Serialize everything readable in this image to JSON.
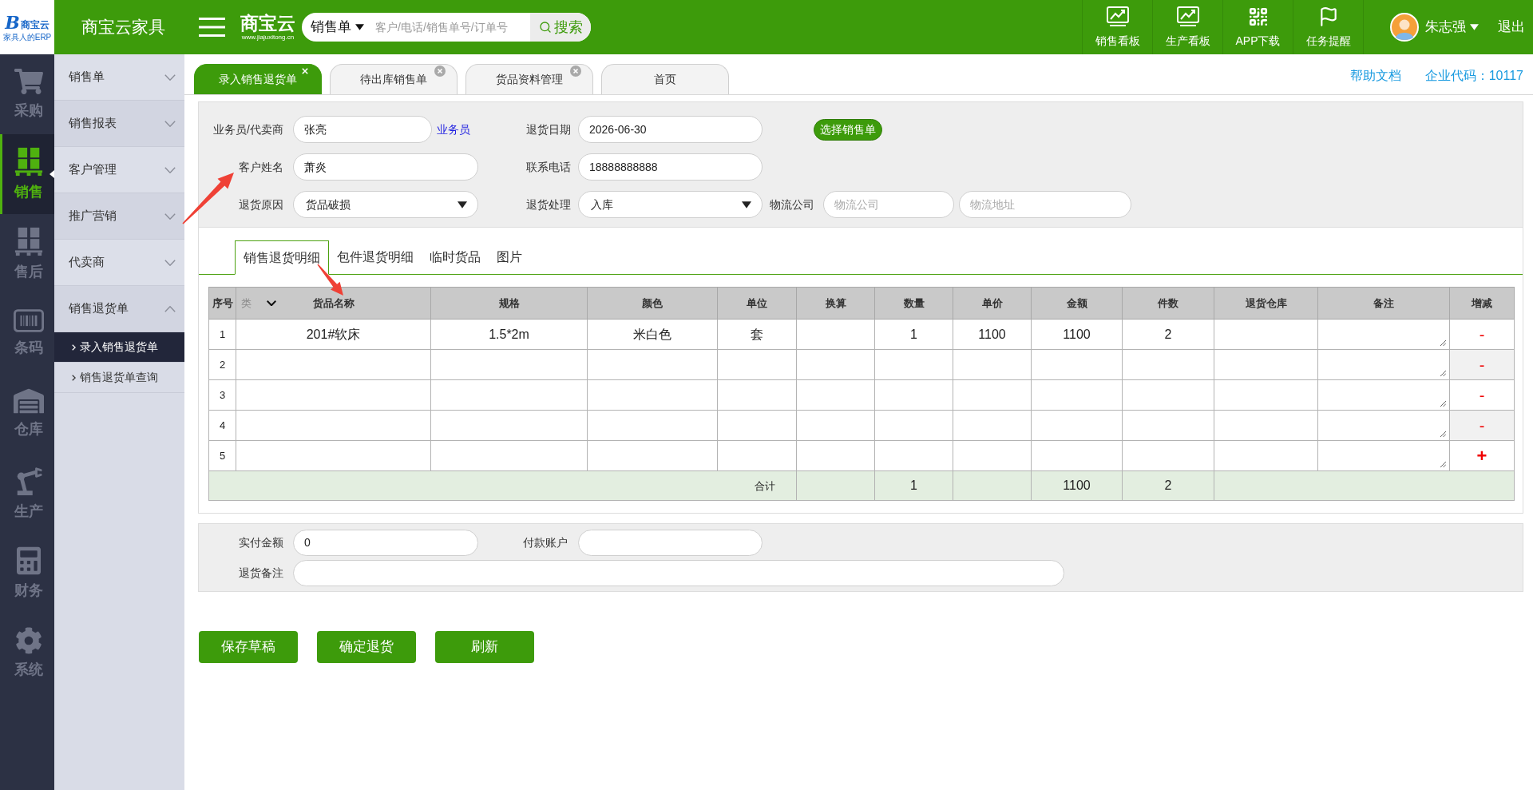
{
  "brand": {
    "logo_mark": "B",
    "logo_name": "商宝云",
    "logo_tagline": "家具人的ERP",
    "company": "商宝云家具",
    "product": "商宝云",
    "product_url": "www.jiajuxitong.cn"
  },
  "search": {
    "scope": "销售单",
    "placeholder": "客户/电话/销售单号/订单号",
    "button": "搜索"
  },
  "toolbar": [
    {
      "kind": "chart",
      "label": "销售看板"
    },
    {
      "kind": "chart",
      "label": "生产看板"
    },
    {
      "kind": "qrcode",
      "label": "APP下载"
    },
    {
      "kind": "flag",
      "label": "任务提醒"
    }
  ],
  "user": {
    "name": "朱志强",
    "logout": "退出"
  },
  "modules": [
    {
      "kind": "cart",
      "label": "采购",
      "selected": false
    },
    {
      "kind": "pallet",
      "label": "销售",
      "selected": true
    },
    {
      "kind": "pallet",
      "label": "售后",
      "selected": false
    },
    {
      "kind": "barcode",
      "label": "条码",
      "selected": false
    },
    {
      "kind": "warehouse",
      "label": "仓库",
      "selected": false
    },
    {
      "kind": "robot",
      "label": "生产",
      "selected": false
    },
    {
      "kind": "calculator",
      "label": "财务",
      "selected": false
    },
    {
      "kind": "gear",
      "label": "系统",
      "selected": false
    }
  ],
  "sidebar": {
    "items": [
      {
        "label": "销售单",
        "expanded": false
      },
      {
        "label": "销售报表",
        "expanded": false
      },
      {
        "label": "客户管理",
        "expanded": false
      },
      {
        "label": "推广营销",
        "expanded": false
      },
      {
        "label": "代卖商",
        "expanded": false
      },
      {
        "label": "销售退货单",
        "expanded": true,
        "children": [
          {
            "label": "录入销售退货单",
            "selected": true
          },
          {
            "label": "销售退货单查询",
            "selected": false
          }
        ]
      }
    ]
  },
  "page_tabs": [
    {
      "label": "录入销售退货单",
      "selected": true,
      "closable": true
    },
    {
      "label": "待出库销售单",
      "selected": false,
      "closable": true
    },
    {
      "label": "货品资料管理",
      "selected": false,
      "closable": true
    },
    {
      "label": "首页",
      "selected": false,
      "closable": false
    }
  ],
  "header_links": {
    "help": "帮助文档",
    "company_code": "企业代码：10117"
  },
  "form": {
    "salesperson": {
      "label": "业务员/代卖商",
      "value": "张亮",
      "link": "业务员"
    },
    "return_date": {
      "label": "退货日期",
      "value": "2026-06-30"
    },
    "select_order_button": "选择销售单",
    "customer_name": {
      "label": "客户姓名",
      "value": "萧炎"
    },
    "phone": {
      "label": "联系电话",
      "value": "18888888888"
    },
    "return_reason": {
      "label": "退货原因",
      "value": "货品破损"
    },
    "return_handling": {
      "label": "退货处理",
      "value": "入库"
    },
    "logistics": {
      "label": "物流公司",
      "company_placeholder": "物流公司",
      "address_placeholder": "物流地址"
    }
  },
  "detail_tabs": [
    {
      "label": "销售退货明细",
      "selected": true
    },
    {
      "label": "包件退货明细",
      "selected": false
    },
    {
      "label": "临时货品",
      "selected": false
    },
    {
      "label": "图片",
      "selected": false
    }
  ],
  "table": {
    "category_filter": "类",
    "columns": [
      "序号",
      "货品名称",
      "规格",
      "颜色",
      "单位",
      "换算",
      "数量",
      "单价",
      "金额",
      "件数",
      "退货仓库",
      "备注",
      "增减"
    ],
    "rows": [
      {
        "no": "1",
        "name": "201#软床",
        "spec": "1.5*2m",
        "color_name": "米白色",
        "unit": "套",
        "quantity": "1",
        "price": "1100",
        "amount": "1100",
        "pieces": "2",
        "action": {
          "kind": "remove",
          "label": "-"
        }
      },
      {
        "no": "2",
        "action": {
          "kind": "remove",
          "label": "-"
        }
      },
      {
        "no": "3",
        "action": {
          "kind": "remove",
          "label": "-"
        }
      },
      {
        "no": "4",
        "action": {
          "kind": "remove",
          "label": "-"
        }
      },
      {
        "no": "5",
        "action": {
          "kind": "add",
          "label": "+"
        }
      }
    ],
    "totals": {
      "label": "合计",
      "quantity": "1",
      "amount": "1100",
      "pieces": "2"
    }
  },
  "payment": {
    "paid_amount": {
      "label": "实付金额",
      "value": "0"
    },
    "account": {
      "label": "付款账户"
    },
    "note": {
      "label": "退货备注"
    }
  },
  "buttons": [
    "保存草稿",
    "确定退货",
    "刷新"
  ],
  "annotations": [
    {
      "kind": "arrow"
    },
    {
      "kind": "arrow"
    }
  ]
}
